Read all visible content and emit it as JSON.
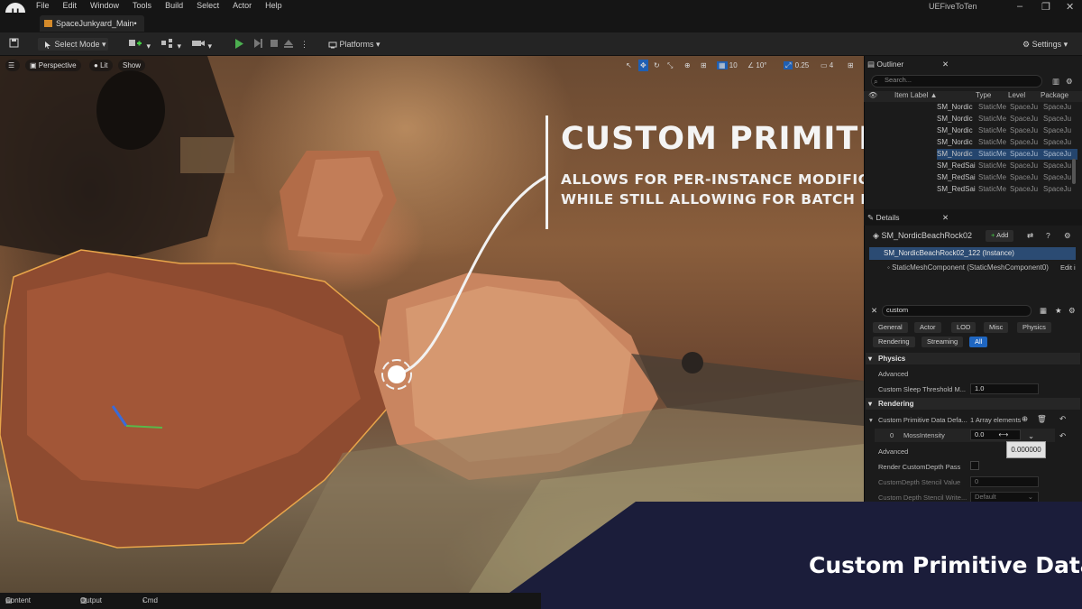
{
  "menubar": {
    "items": [
      "File",
      "Edit",
      "Window",
      "Tools",
      "Build",
      "Select",
      "Actor",
      "Help"
    ],
    "project_badge": "UEFiveToTen"
  },
  "tab": {
    "label": "SpaceJunkyard_Main•"
  },
  "toolbar": {
    "select_mode": "Select Mode",
    "platforms": "Platforms",
    "settings": "Settings"
  },
  "viewport": {
    "perspective": "Perspective",
    "lit": "Lit",
    "show": "Show",
    "grid_snap": "10",
    "rot_snap": "10°",
    "scale_snap": "0.25",
    "camera_speed": "4"
  },
  "overlay": {
    "title": "CUSTOM PRIMITIVE DATA",
    "sub1": "ALLOWS FOR PER-INSTANCE MODIFICATIONS",
    "sub2": "WHILE STILL ALLOWING FOR BATCH RENDERING"
  },
  "outliner": {
    "title": "Outliner",
    "search_placeholder": "Search...",
    "columns": [
      "Item Label ▲",
      "Type",
      "Level",
      "Package"
    ],
    "rows": [
      {
        "label": "SM_Nordic",
        "type": "StaticMe",
        "level": "SpaceJu",
        "package": "SpaceJu"
      },
      {
        "label": "SM_Nordic",
        "type": "StaticMe",
        "level": "SpaceJu",
        "package": "SpaceJu"
      },
      {
        "label": "SM_Nordic",
        "type": "StaticMe",
        "level": "SpaceJu",
        "package": "SpaceJu"
      },
      {
        "label": "SM_Nordic",
        "type": "StaticMe",
        "level": "SpaceJu",
        "package": "SpaceJu"
      },
      {
        "label": "SM_Nordic",
        "type": "StaticMe",
        "level": "SpaceJu",
        "package": "SpaceJu"
      },
      {
        "label": "SM_RedSai",
        "type": "StaticMe",
        "level": "SpaceJu",
        "package": "SpaceJu"
      },
      {
        "label": "SM_RedSai",
        "type": "StaticMe",
        "level": "SpaceJu",
        "package": "SpaceJu"
      },
      {
        "label": "SM_RedSai",
        "type": "StaticMe",
        "level": "SpaceJu",
        "package": "SpaceJu"
      }
    ]
  },
  "details": {
    "title": "Details",
    "actor_name": "SM_NordicBeachRock02",
    "add": "Add",
    "instance": "SM_NordicBeachRock02_122 (Instance)",
    "component": "StaticMeshComponent (StaticMeshComponent0)",
    "edit": "Edit i",
    "search_value": "custom",
    "filters": [
      "General",
      "Actor",
      "LOD",
      "Misc",
      "Physics",
      "Rendering",
      "Streaming",
      "All"
    ],
    "physics": "Physics",
    "advanced1": "Advanced",
    "sleep_label": "Custom Sleep Threshold M...",
    "sleep_value": "1.0",
    "rendering": "Rendering",
    "cpd_label": "Custom Primitive Data Defa...",
    "cpd_count": "1 Array elements",
    "element_index": "0",
    "element_name": "MossIntensity",
    "element_value": "0.0",
    "tooltip": "0.000000",
    "advanced2": "Advanced",
    "depth_pass": "Render CustomDepth Pass",
    "stencil_label": "CustomDepth Stencil Value",
    "stencil_value": "0",
    "stencil_write_label": "Custom Depth Stencil Write...",
    "stencil_write_value": "Default"
  },
  "banner": {
    "text": "Custom Primitive Data"
  },
  "statusbar": {
    "content_drawer": "Content Drawer",
    "output_log": "Output Log",
    "cmd": "Cmd"
  }
}
